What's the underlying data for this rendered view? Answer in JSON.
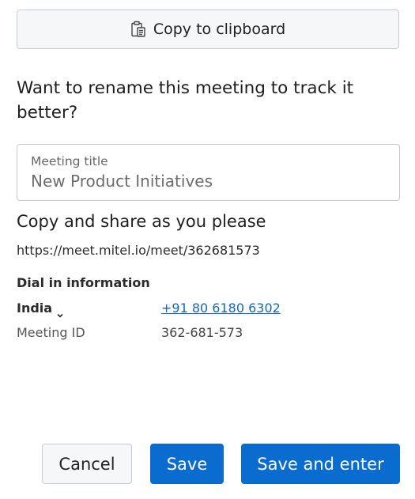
{
  "copy_button": {
    "label": "Copy to clipboard",
    "icon": "clipboard-icon"
  },
  "rename": {
    "heading": "Want to rename this meeting to track it better?",
    "field_label": "Meeting title",
    "field_value": "New Product Initiatives"
  },
  "share": {
    "heading": "Copy and share as you please",
    "url": "https://meet.mitel.io/meet/362681573"
  },
  "dial_in": {
    "heading": "Dial in information",
    "country": "India",
    "country_icon": "chevron-down-icon",
    "phone": "+91 80 6180 6302",
    "meeting_id_label": "Meeting ID",
    "meeting_id_value": "362-681-573"
  },
  "actions": {
    "cancel": "Cancel",
    "save": "Save",
    "save_and_enter": "Save and enter"
  },
  "colors": {
    "primary": "#0a6ccf",
    "link": "#1469b8"
  }
}
